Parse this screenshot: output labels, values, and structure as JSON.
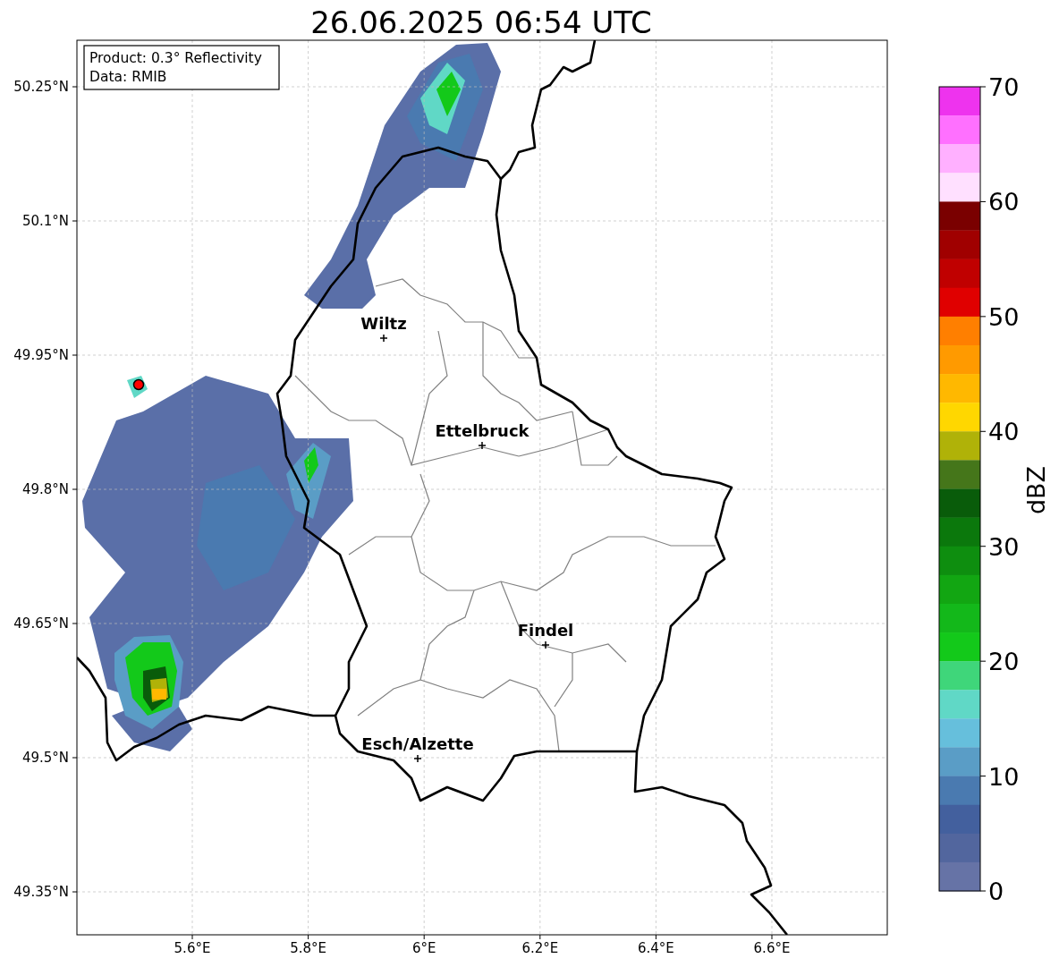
{
  "title": "26.06.2025 06:54 UTC",
  "info_box": {
    "lines": [
      "Product: 0.3° Reflectivity",
      "Data: RMIB"
    ]
  },
  "map": {
    "xticks": [
      "5.6°E",
      "5.8°E",
      "6°E",
      "6.2°E",
      "6.4°E",
      "6.6°E"
    ],
    "yticks": [
      "50.25°N",
      "50.1°N",
      "49.95°N",
      "49.8°N",
      "49.65°N",
      "49.5°N",
      "49.35°N"
    ],
    "cities": [
      {
        "name": "Wiltz"
      },
      {
        "name": "Ettelbruck"
      },
      {
        "name": "Findel"
      },
      {
        "name": "Esch/Alzette"
      }
    ]
  },
  "colorbar": {
    "label": "dBZ",
    "ticks": [
      "70",
      "60",
      "50",
      "40",
      "30",
      "20",
      "10",
      "0"
    ],
    "bands": [
      {
        "color": "#ee33ee"
      },
      {
        "color": "#ff70ff"
      },
      {
        "color": "#ffb0ff"
      },
      {
        "color": "#ffe0ff"
      },
      {
        "color": "#7a0000"
      },
      {
        "color": "#a00000"
      },
      {
        "color": "#c00000"
      },
      {
        "color": "#e00000"
      },
      {
        "color": "#ff7f00"
      },
      {
        "color": "#ff9a00"
      },
      {
        "color": "#ffb800"
      },
      {
        "color": "#ffd700"
      },
      {
        "color": "#b0b208"
      },
      {
        "color": "#45761a"
      },
      {
        "color": "#095c0a"
      },
      {
        "color": "#0b780c"
      },
      {
        "color": "#0e8e0f"
      },
      {
        "color": "#12a612"
      },
      {
        "color": "#13b81a"
      },
      {
        "color": "#13c91a"
      },
      {
        "color": "#3fd67a"
      },
      {
        "color": "#60d8c6"
      },
      {
        "color": "#66bfdc"
      },
      {
        "color": "#5a9dc6"
      },
      {
        "color": "#4a7ab0"
      },
      {
        "color": "#43609e"
      },
      {
        "color": "#52669e"
      },
      {
        "color": "#6673a6"
      }
    ]
  }
}
